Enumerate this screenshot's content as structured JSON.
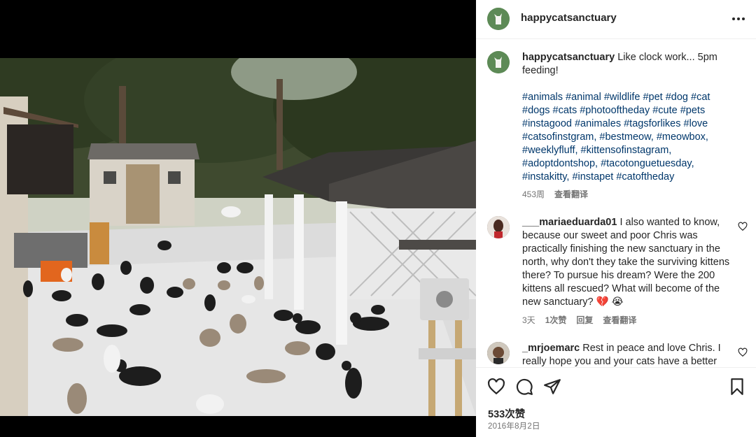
{
  "post": {
    "username": "happycatsanctuary",
    "caption_text": "Like clock work... 5pm feeding!",
    "hashtags": "#animals #animal #wildlife #pet #dog #cat #dogs #cats #photooftheday #cute #pets #instagood #animales #tagsforlikes #love #catsofinstgram, #bestmeow, #meowbox, #weeklyfluff, #kittensofinstagram, #adoptdontshop, #tacotonguetuesday, #instakitty, #instapet #catoftheday",
    "caption_age": "453周",
    "see_translation": "查看翻译",
    "likes": "533次赞",
    "date": "2016年8月2日"
  },
  "comments": [
    {
      "username": "___mariaeduarda01",
      "text": "I also wanted to know, because our sweet and poor Chris was practically finishing the new sanctuary in the north, why don't they take the surviving kittens there? To pursue his dream? Were the 200 kittens all rescued? What will become of the new sanctuary? 💔 😭",
      "age": "3天",
      "likes": "1次赞",
      "reply": "回复",
      "see_translation": "查看翻译"
    },
    {
      "username": "_mrjoemarc",
      "text": "Rest in peace and love Chris. I really hope you and your cats have a better"
    }
  ],
  "icons": {
    "more": "more-options-icon",
    "like": "heart-icon",
    "comment": "comment-icon",
    "share": "share-icon",
    "save": "bookmark-icon"
  },
  "colors": {
    "avatar_green": "#5d8a56",
    "hashtag_blue": "#00376b",
    "meta_gray": "#737373"
  }
}
